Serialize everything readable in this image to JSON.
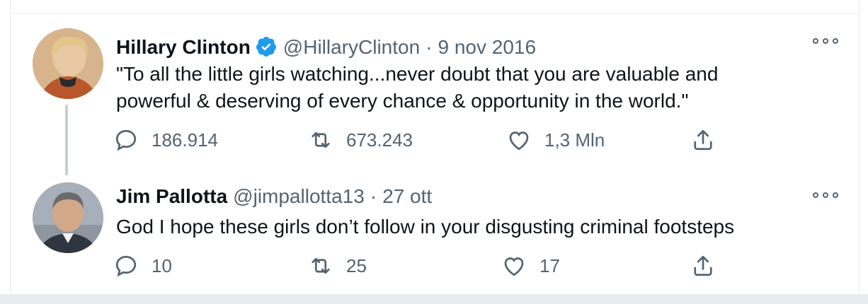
{
  "tweets": [
    {
      "author_name": "Hillary Clinton",
      "verified": true,
      "handle": "@HillaryClinton",
      "separator": "·",
      "date": "9 nov 2016",
      "text_line1": "\"To all the little girls watching...never doubt that you are valuable and",
      "text_line2": "powerful & deserving of every chance & opportunity in the world.\"",
      "replies": "186.914",
      "retweets": "673.243",
      "likes": "1,3 Mln"
    },
    {
      "author_name": "Jim Pallotta",
      "verified": false,
      "handle": "@jimpallotta13",
      "separator": "·",
      "date": "27 ott",
      "text_line1": "God I hope these girls don’t follow in your disgusting criminal footsteps",
      "replies": "10",
      "retweets": "25",
      "likes": "17"
    }
  ],
  "colors": {
    "text": "#0f1419",
    "secondary": "#536471",
    "verified_blue": "#1d9bf0",
    "divider": "#e6ecf0",
    "thread_line": "#c4cfd6"
  },
  "icons": [
    "reply-icon",
    "retweet-icon",
    "like-icon",
    "share-icon",
    "more-icon",
    "verified-badge-icon"
  ]
}
